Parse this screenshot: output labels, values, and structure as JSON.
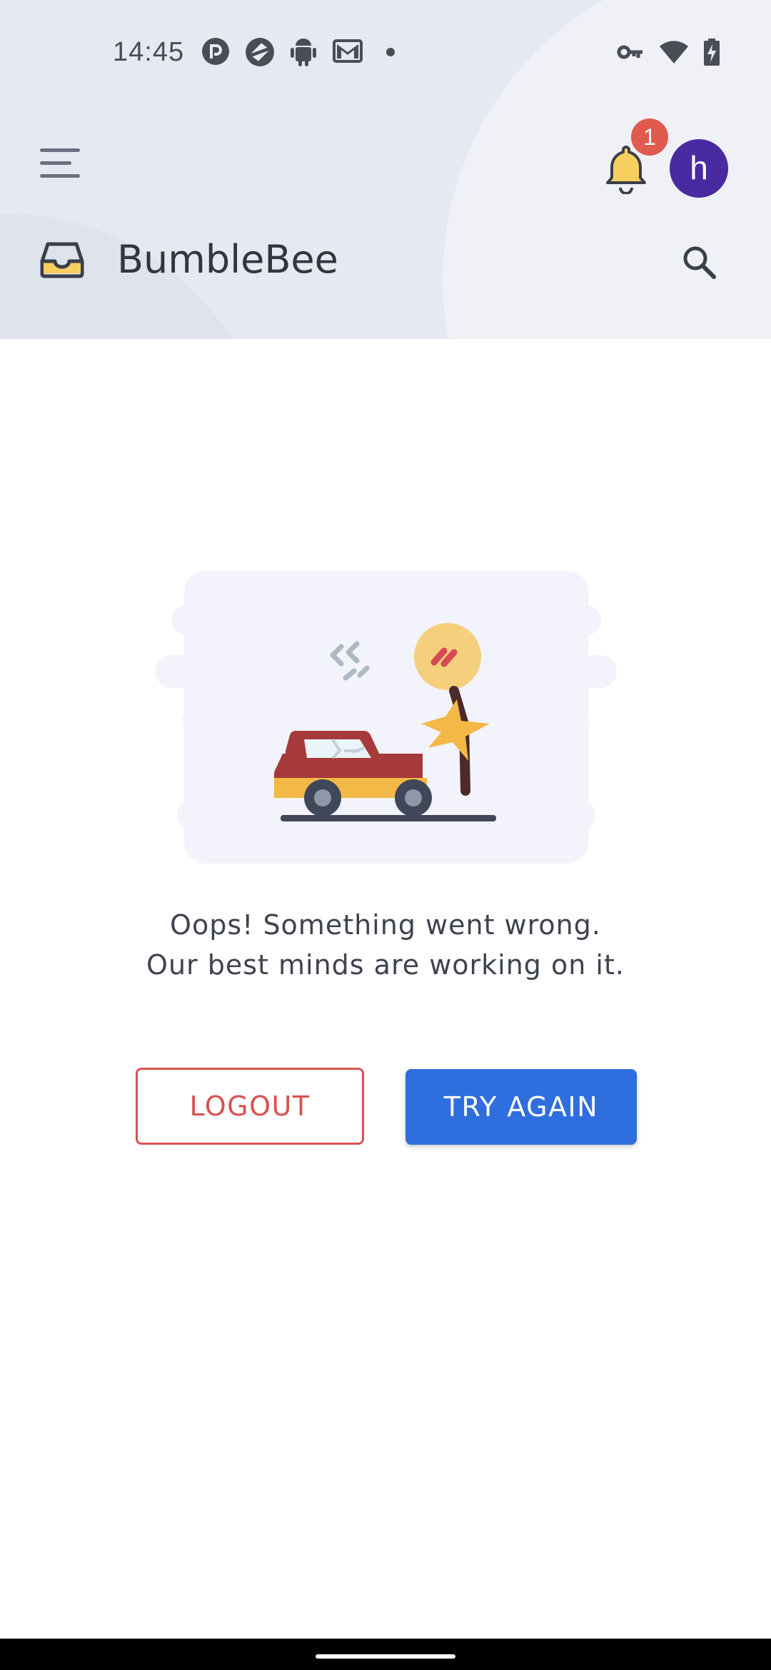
{
  "status_bar": {
    "time": "14:45",
    "notification_icons": [
      "pocketcasts-icon",
      "camera-app-icon",
      "android-icon",
      "gmail-icon",
      "dot-icon"
    ],
    "system_icons": [
      "vpn-key-icon",
      "wifi-icon",
      "battery-charging-icon"
    ]
  },
  "header": {
    "app_title": "BumbleBee",
    "notification_count": "1",
    "avatar_letter": "h"
  },
  "error": {
    "line1": "Oops! Something went wrong.",
    "line2": "Our best minds are working on it."
  },
  "actions": {
    "logout_label": "LOGOUT",
    "retry_label": "TRY AGAIN"
  },
  "colors": {
    "header_bg": "#eaecf4",
    "logout": "#d85352",
    "primary": "#2f6ede",
    "avatar": "#4a2aa0",
    "badge": "#e05a50"
  }
}
